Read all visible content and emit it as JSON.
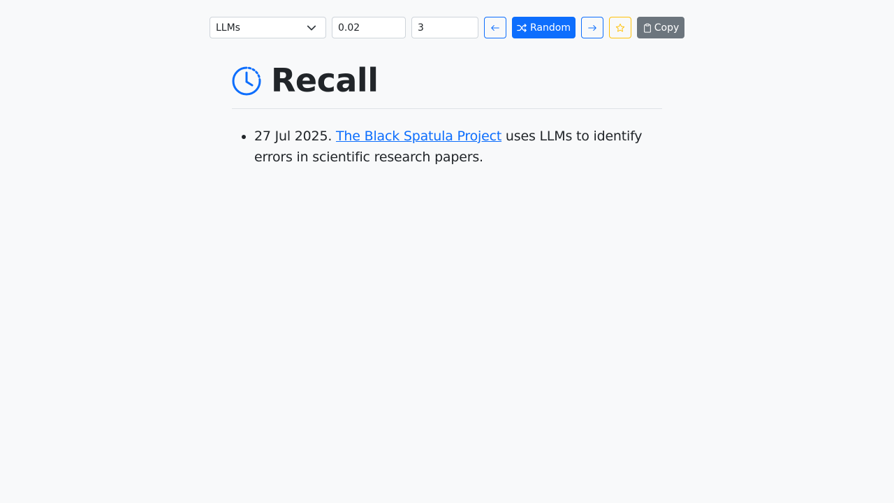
{
  "toolbar": {
    "topic_select": {
      "selected": "LLMs"
    },
    "temperature_input": {
      "value": "0.02"
    },
    "count_input": {
      "value": "3"
    },
    "prev_icon": "arrow-left-icon",
    "random_label": "Random",
    "random_icon": "shuffle-icon",
    "next_icon": "arrow-right-icon",
    "star_icon": "star-icon",
    "copy_label": "Copy",
    "copy_icon": "clipboard-icon"
  },
  "header": {
    "icon": "clock-icon",
    "title": "Recall"
  },
  "entries": [
    {
      "date": "27 Jul 2025.",
      "link_text": "The Black Spatula Project",
      "text": "uses LLMs to identify errors in scientific research papers."
    }
  ],
  "colors": {
    "primary": "#0d6efd",
    "warning": "#ffc107",
    "secondary": "#6c757d",
    "background": "#f8f9fa",
    "text": "#212529"
  }
}
